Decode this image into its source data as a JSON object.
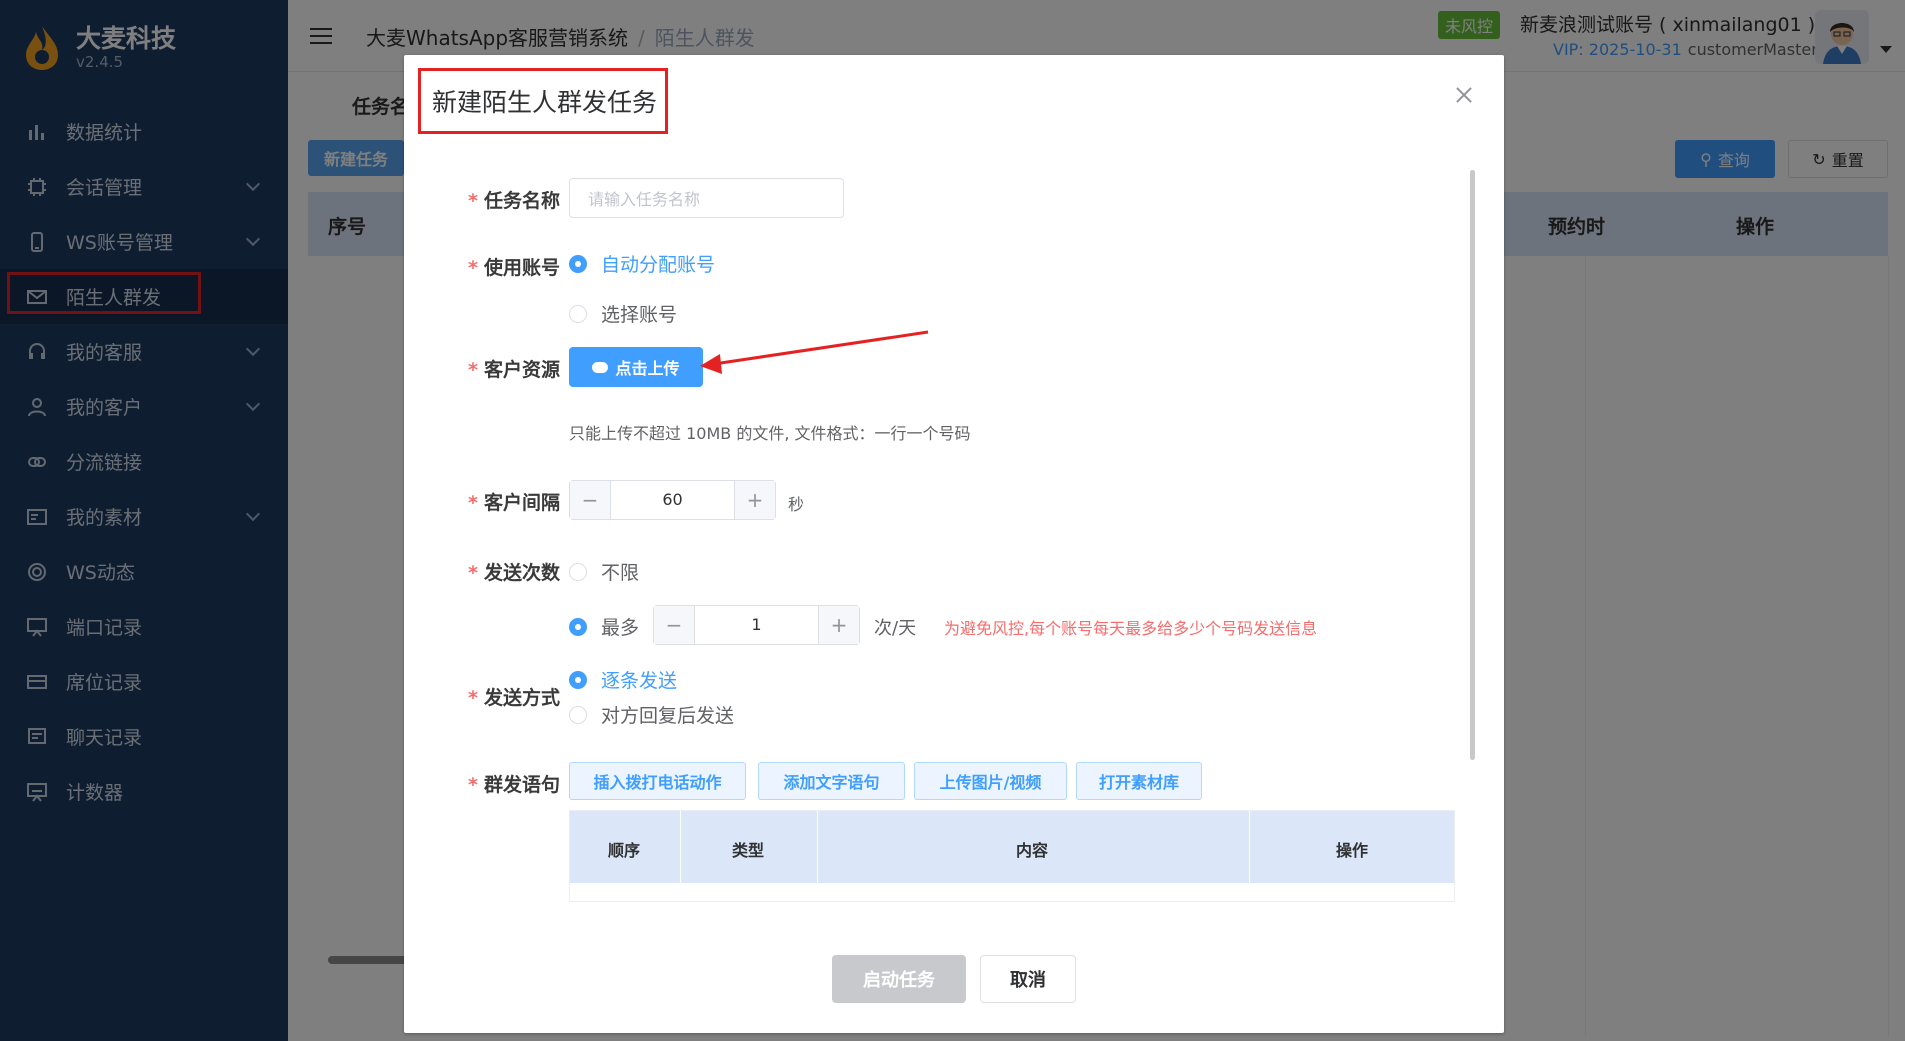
{
  "app": {
    "logo_name": "大麦科技",
    "version": "v2.4.5"
  },
  "sidebar": {
    "items": [
      {
        "label": "数据统计",
        "icon": "bar-chart-icon",
        "has_children": false
      },
      {
        "label": "会话管理",
        "icon": "chip-icon",
        "has_children": true
      },
      {
        "label": "WS账号管理",
        "icon": "phone-icon",
        "has_children": true
      },
      {
        "label": "陌生人群发",
        "icon": "mail-icon",
        "has_children": false,
        "active": true
      },
      {
        "label": "我的客服",
        "icon": "headset-icon",
        "has_children": true
      },
      {
        "label": "我的客户",
        "icon": "user-icon",
        "has_children": true
      },
      {
        "label": "分流链接",
        "icon": "link-icon",
        "has_children": false
      },
      {
        "label": "我的素材",
        "icon": "material-icon",
        "has_children": true
      },
      {
        "label": "WS动态",
        "icon": "moment-icon",
        "has_children": false
      },
      {
        "label": "端口记录",
        "icon": "port-icon",
        "has_children": false
      },
      {
        "label": "席位记录",
        "icon": "seat-icon",
        "has_children": false
      },
      {
        "label": "聊天记录",
        "icon": "chat-icon",
        "has_children": false
      },
      {
        "label": "计数器",
        "icon": "counter-icon",
        "has_children": false
      }
    ]
  },
  "header": {
    "breadcrumb_root": "大麦WhatsApp客服营销系统",
    "breadcrumb_sep": "/",
    "breadcrumb_current": "陌生人群发",
    "risk_badge": "未风控",
    "account": "新麦浪测试账号 ( xinmailang01 )",
    "vip": "VIP: 2025-10-31",
    "role": "customerMaster"
  },
  "background": {
    "label_task": "任务名",
    "btn_new": "新建任务",
    "btn_query": "查询",
    "btn_reset": "重置",
    "col_index": "序号",
    "col_schedule": "预约时",
    "col_action": "操作"
  },
  "dialog": {
    "title": "新建陌生人群发任务",
    "task_name": {
      "label": "任务名称",
      "placeholder": "请输入任务名称",
      "value": ""
    },
    "account": {
      "label": "使用账号",
      "options": [
        "自动分配账号",
        "选择账号"
      ],
      "selected": "自动分配账号"
    },
    "resource": {
      "label": "客户资源",
      "upload_label": "点击上传",
      "hint": "只能上传不超过 10MB 的文件, 文件格式：一行一个号码"
    },
    "interval": {
      "label": "客户间隔",
      "value": "60",
      "unit": "秒"
    },
    "send_count": {
      "label": "发送次数",
      "unlimited": "不限",
      "max": "最多",
      "max_value": "1",
      "unit": "次/天",
      "warning": "为避免风控,每个账号每天最多给多少个号码发送信息",
      "selected": "最多"
    },
    "send_mode": {
      "label": "发送方式",
      "options": [
        "逐条发送",
        "对方回复后发送"
      ],
      "selected": "逐条发送"
    },
    "messages": {
      "label": "群发语句",
      "buttons": [
        "插入拨打电话动作",
        "添加文字语句",
        "上传图片/视频",
        "打开素材库"
      ],
      "columns": [
        "顺序",
        "类型",
        "内容",
        "操作"
      ]
    },
    "footer": {
      "start": "启动任务",
      "cancel": "取消"
    }
  },
  "colors": {
    "sidebar_bg": "#1f3a63",
    "accent": "#409eff",
    "danger": "#e52222",
    "badge": "#67c23a"
  }
}
